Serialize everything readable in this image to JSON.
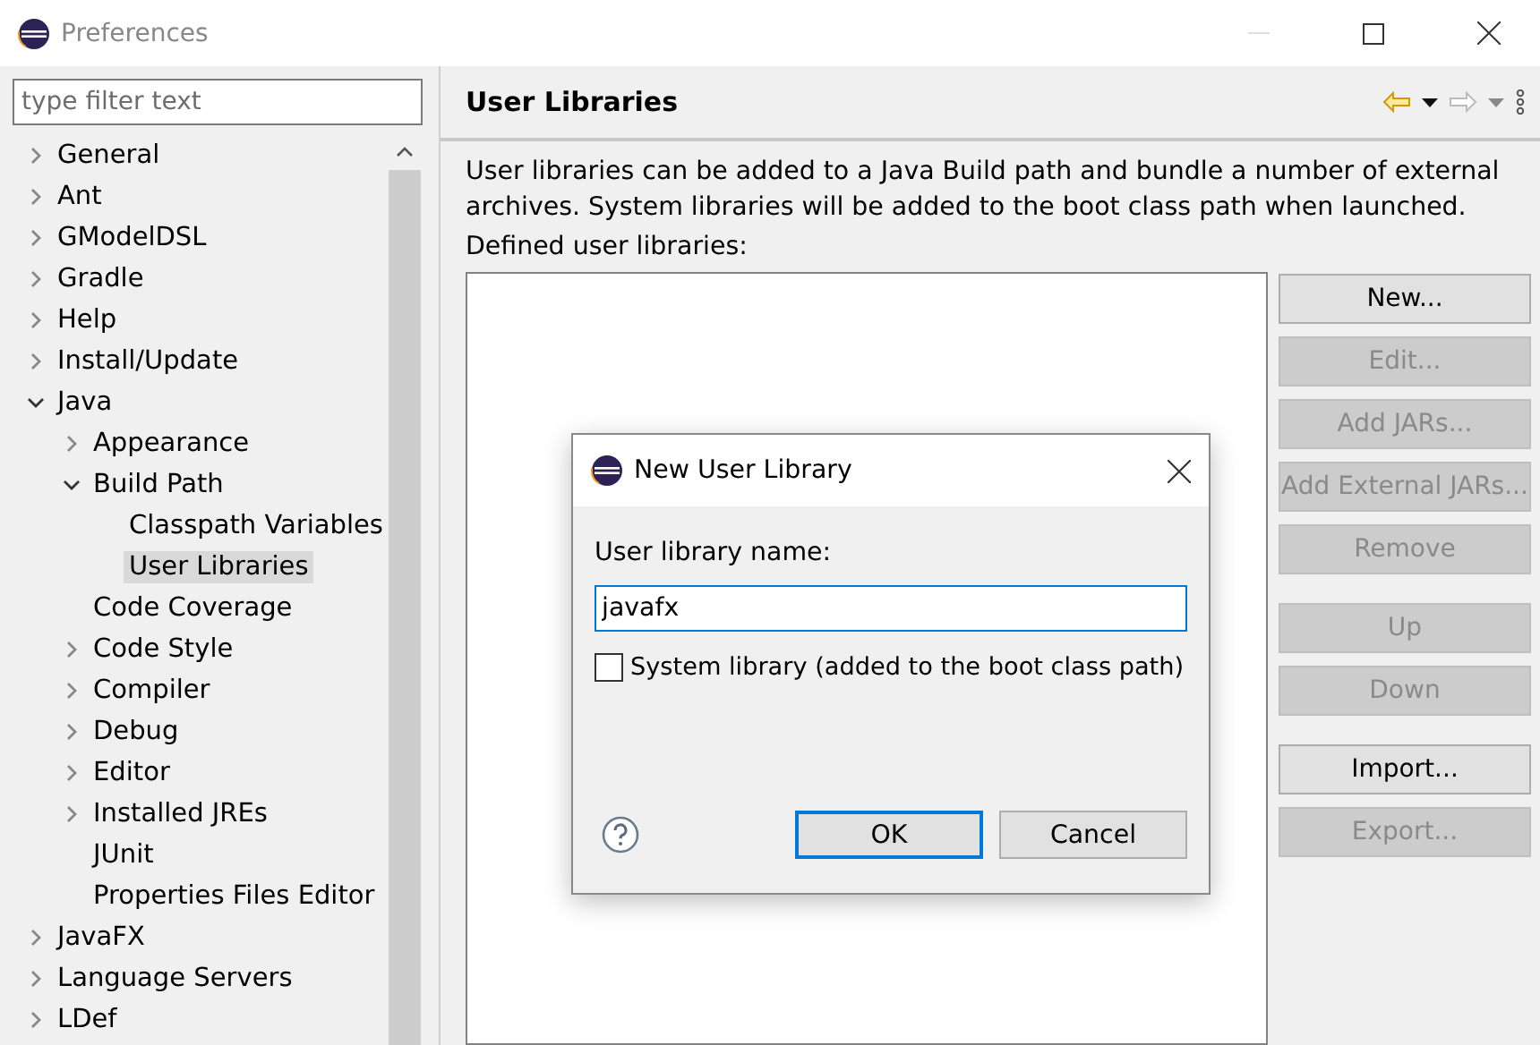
{
  "window": {
    "title": "Preferences"
  },
  "filter": {
    "placeholder": "type filter text"
  },
  "tree": [
    {
      "label": "General",
      "expanded": false,
      "selected": false
    },
    {
      "label": "Ant",
      "expanded": false,
      "selected": false
    },
    {
      "label": "GModelDSL",
      "expanded": false,
      "selected": false
    },
    {
      "label": "Gradle",
      "expanded": false,
      "selected": false
    },
    {
      "label": "Help",
      "expanded": false,
      "selected": false
    },
    {
      "label": "Install/Update",
      "expanded": false,
      "selected": false
    },
    {
      "label": "Java",
      "expanded": true,
      "selected": false,
      "children": [
        {
          "label": "Appearance",
          "expanded": false,
          "selected": false
        },
        {
          "label": "Build Path",
          "expanded": true,
          "selected": false,
          "children": [
            {
              "label": "Classpath Variables",
              "selected": false
            },
            {
              "label": "User Libraries",
              "selected": true
            }
          ]
        },
        {
          "label": "Code Coverage",
          "selected": false
        },
        {
          "label": "Code Style",
          "expanded": false,
          "selected": false
        },
        {
          "label": "Compiler",
          "expanded": false,
          "selected": false
        },
        {
          "label": "Debug",
          "expanded": false,
          "selected": false
        },
        {
          "label": "Editor",
          "expanded": false,
          "selected": false
        },
        {
          "label": "Installed JREs",
          "expanded": false,
          "selected": false
        },
        {
          "label": "JUnit",
          "selected": false
        },
        {
          "label": "Properties Files Editor",
          "selected": false
        }
      ]
    },
    {
      "label": "JavaFX",
      "expanded": false,
      "selected": false
    },
    {
      "label": "Language Servers",
      "expanded": false,
      "selected": false
    },
    {
      "label": "LDef",
      "expanded": false,
      "selected": false
    }
  ],
  "page": {
    "title": "User Libraries",
    "description": "User libraries can be added to a Java Build path and bundle a number of external archives. System libraries will be added to the boot class path when launched.",
    "list_label": "Defined user libraries:"
  },
  "button_groups": [
    [
      {
        "label": "New...",
        "disabled": false
      },
      {
        "label": "Edit...",
        "disabled": true
      },
      {
        "label": "Add JARs...",
        "disabled": true
      },
      {
        "label": "Add External JARs...",
        "disabled": true
      },
      {
        "label": "Remove",
        "disabled": true
      }
    ],
    [
      {
        "label": "Up",
        "disabled": true
      },
      {
        "label": "Down",
        "disabled": true
      }
    ],
    [
      {
        "label": "Import...",
        "disabled": false
      },
      {
        "label": "Export...",
        "disabled": true
      }
    ]
  ],
  "dialog": {
    "title": "New User Library",
    "name_label": "User library name:",
    "name_value": "javafx",
    "system_library": {
      "label": "System library (added to the boot class path)",
      "checked": false
    },
    "buttons": [
      {
        "label": "OK",
        "default": true
      },
      {
        "label": "Cancel",
        "default": false
      }
    ]
  }
}
